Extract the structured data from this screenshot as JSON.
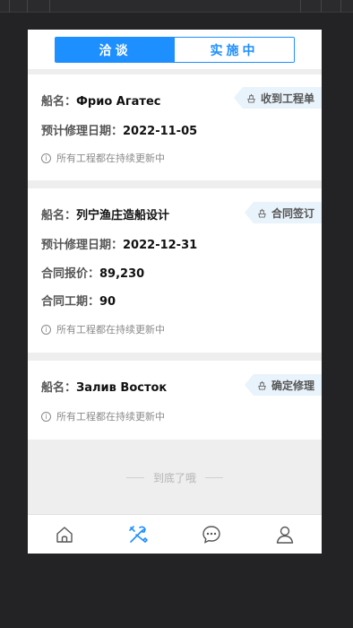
{
  "tabs": [
    {
      "label": "洽谈",
      "active": true
    },
    {
      "label": "实施中",
      "active": false
    }
  ],
  "cards": [
    {
      "ship_label": "船名：",
      "ship_name": "Фрио Агатес",
      "badge": "收到工程单",
      "date_label": "预计修理日期：",
      "date_value": "2022-11-05",
      "note": "所有工程都在持续更新中"
    },
    {
      "ship_label": "船名：",
      "ship_name": "列宁渔庄造船设计",
      "badge": "合同签订",
      "date_label": "预计修理日期：",
      "date_value": "2022-12-31",
      "price_label": "合同报价：",
      "price_value": "89,230",
      "period_label": "合同工期：",
      "period_value": "90",
      "note": "所有工程都在持续更新中"
    },
    {
      "ship_label": "船名：",
      "ship_name": "Залив Восток",
      "badge": "确定修理",
      "note": "所有工程都在持续更新中"
    }
  ],
  "end_text": "到底了哦",
  "nav": [
    {
      "icon": "home-icon",
      "active": false
    },
    {
      "icon": "tools-icon",
      "active": true
    },
    {
      "icon": "message-icon",
      "active": false
    },
    {
      "icon": "user-icon",
      "active": false
    }
  ],
  "colors": {
    "accent": "#1e8fff",
    "page_bg": "#eeeeee",
    "badge_bg": "#e9f3fb"
  }
}
